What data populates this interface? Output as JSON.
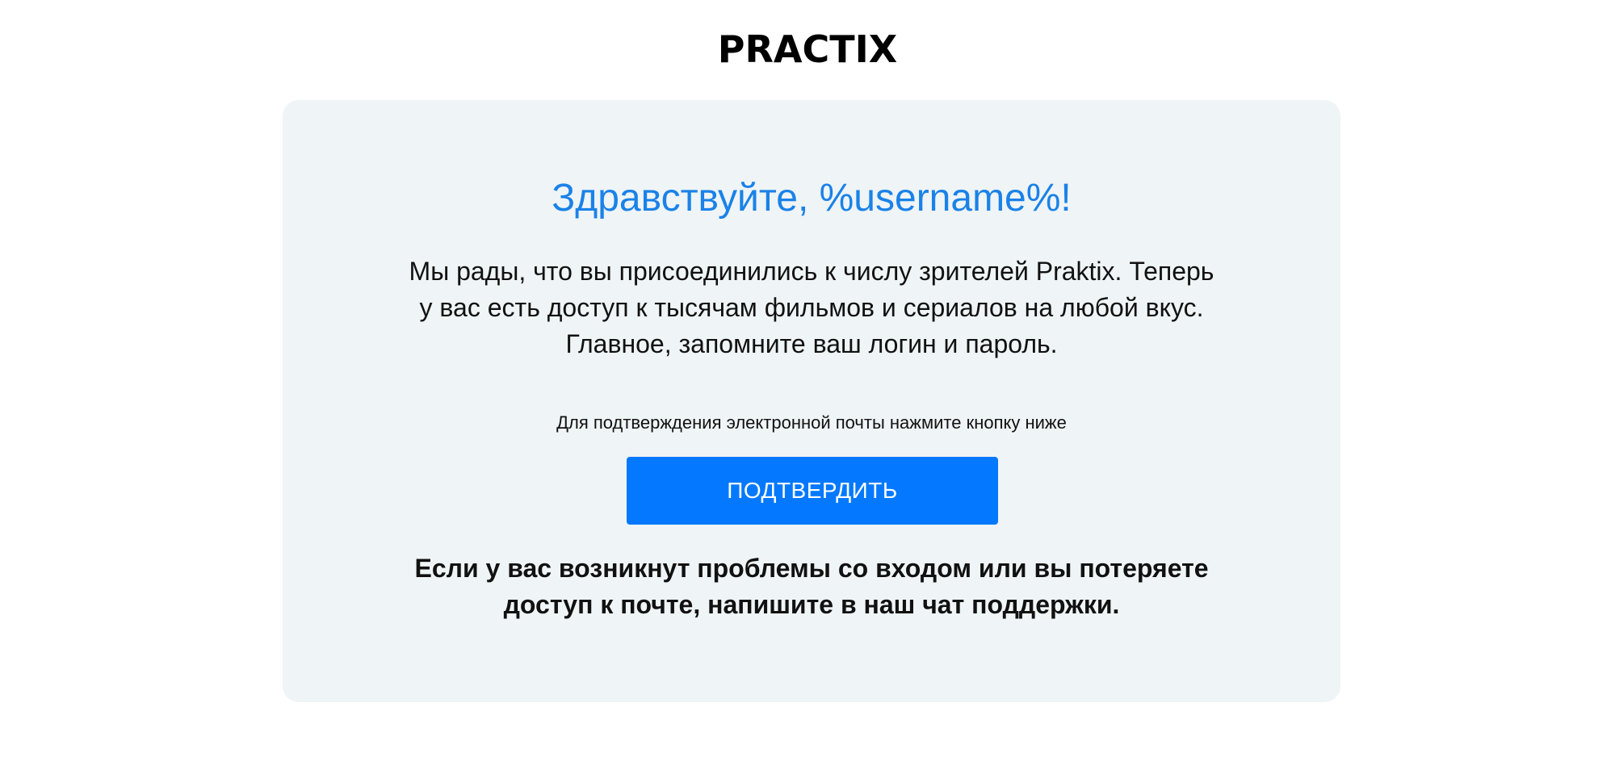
{
  "header": {
    "logo_text": "PRACTIX"
  },
  "card": {
    "greeting": "Здравствуйте, %username%!",
    "intro": "Мы рады, что вы присоединились к числу зрителей Praktix. Теперь у вас есть доступ к тысячам фильмов и сериалов на любой вкус. Главное, запомните ваш логин и пароль.",
    "confirm_hint": "Для подтверждения электронной почты нажмите кнопку ниже",
    "confirm_button_label": "ПОДТВЕРДИТЬ",
    "support_note": "Если у вас возникнут проблемы со входом или вы потеряете доступ к почте, напишите в наш чат поддержки."
  },
  "colors": {
    "accent": "#0479ff",
    "greeting": "#1a82e8",
    "card_background": "#eff4f6",
    "text": "#111111"
  }
}
